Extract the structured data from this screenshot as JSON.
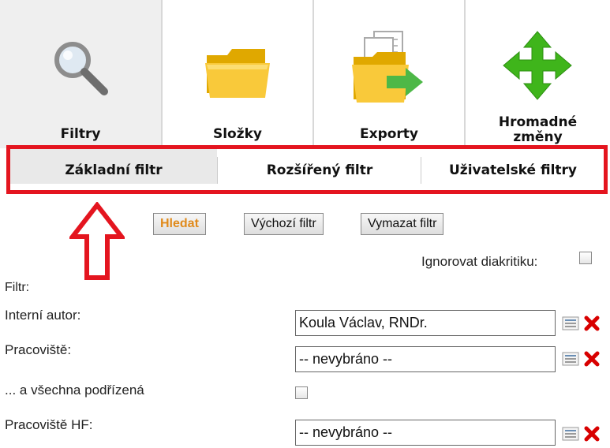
{
  "toolbar": {
    "tiles": [
      {
        "label": "Filtry",
        "icon": "magnifier-icon"
      },
      {
        "label": "Složky",
        "icon": "folder-icon"
      },
      {
        "label": "Exporty",
        "icon": "export-icon"
      },
      {
        "label_line1": "Hromadné",
        "label_line2": "změny",
        "icon": "move-arrows-icon"
      }
    ]
  },
  "tabs": [
    {
      "label": "Základní filtr",
      "active": true
    },
    {
      "label": "Rozšířený filtr",
      "active": false
    },
    {
      "label": "Uživatelské filtry",
      "active": false
    }
  ],
  "buttons": {
    "search": "Hledat",
    "default": "Výchozí filtr",
    "clear": "Vymazat filtr"
  },
  "options": {
    "ignore_diacritics": "Ignorovat diakritiku:"
  },
  "filter": {
    "title": "Filtr:",
    "rows": [
      {
        "label": "Interní autor:",
        "value": "Koula Václav, RNDr."
      },
      {
        "label": "Pracoviště:",
        "value": "-- nevybráno --"
      },
      {
        "label": "... a všechna podřízená"
      },
      {
        "label": "Pracoviště HF:",
        "value": "-- nevybráno --"
      }
    ]
  },
  "colors": {
    "highlight": "#e4151f",
    "search_button_text": "#e08a1b",
    "delete_icon": "#d80000",
    "arrow_green": "#3fb51b"
  }
}
